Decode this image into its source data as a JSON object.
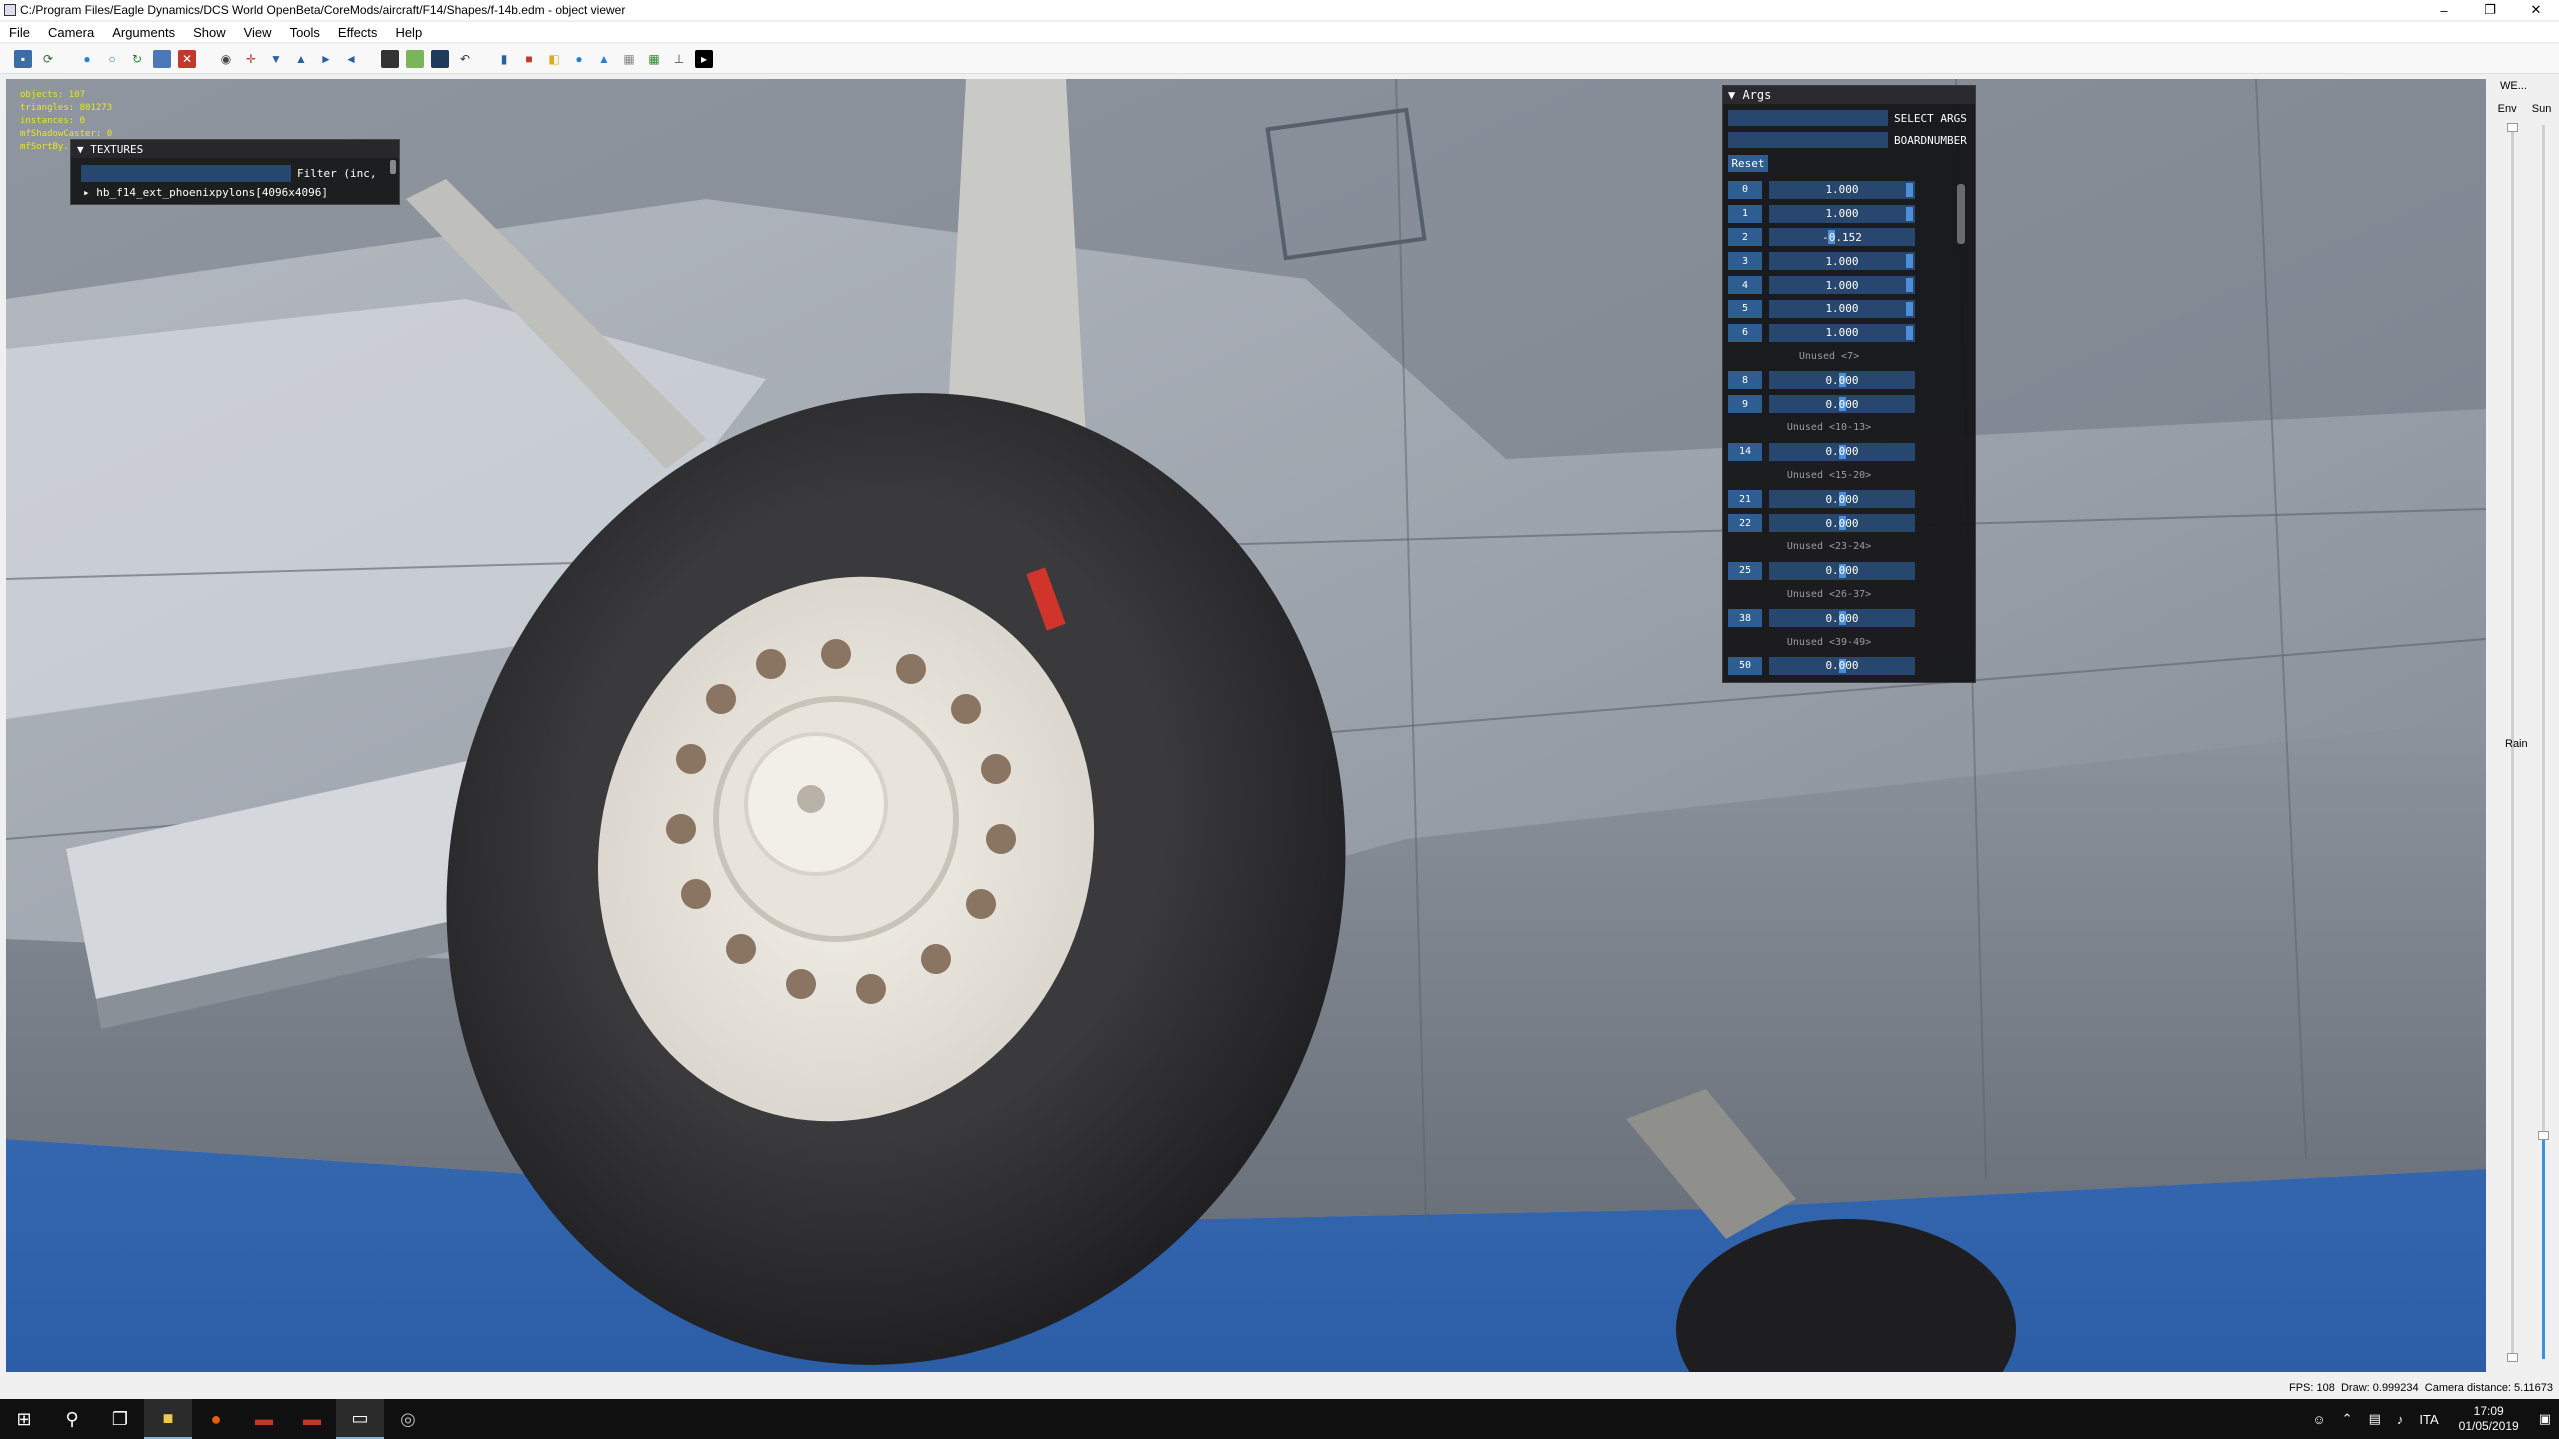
{
  "window": {
    "title": "C:/Program Files/Eagle Dynamics/DCS World OpenBeta/CoreMods/aircraft/F14/Shapes/f-14b.edm - object viewer",
    "minimize": "–",
    "maximize": "❐",
    "close": "✕"
  },
  "menu": [
    "File",
    "Camera",
    "Arguments",
    "Show",
    "View",
    "Tools",
    "Effects",
    "Help"
  ],
  "overlay_stats": [
    "objects: 107",
    "triangles: 801273",
    "instances: 0",
    "mfShadowCaster: 0",
    "mfSortBy..."
  ],
  "textures_panel": {
    "title": "TEXTURES",
    "filter_label": "Filter (inc,",
    "item": "hb_f14_ext_phoenixpylons[4096x4096]"
  },
  "args_panel": {
    "title": "Args",
    "select_label": "SELECT ARGS",
    "board_label": "BOARDNUMBER",
    "reset_label": "Reset",
    "rows": [
      {
        "kind": "arg",
        "index": "0",
        "value": "1.000",
        "fill": 1.0
      },
      {
        "kind": "arg",
        "index": "1",
        "value": "1.000",
        "fill": 1.0
      },
      {
        "kind": "arg",
        "index": "2",
        "value": "-0.152",
        "fill": 0.42
      },
      {
        "kind": "arg",
        "index": "3",
        "value": "1.000",
        "fill": 1.0
      },
      {
        "kind": "arg",
        "index": "4",
        "value": "1.000",
        "fill": 1.0
      },
      {
        "kind": "arg",
        "index": "5",
        "value": "1.000",
        "fill": 1.0
      },
      {
        "kind": "arg",
        "index": "6",
        "value": "1.000",
        "fill": 1.0
      },
      {
        "kind": "unused",
        "label": "Unused <7>"
      },
      {
        "kind": "arg",
        "index": "8",
        "value": "0.000",
        "fill": 0.5
      },
      {
        "kind": "arg",
        "index": "9",
        "value": "0.000",
        "fill": 0.5
      },
      {
        "kind": "unused",
        "label": "Unused <10-13>"
      },
      {
        "kind": "arg",
        "index": "14",
        "value": "0.000",
        "fill": 0.5
      },
      {
        "kind": "unused",
        "label": "Unused <15-20>"
      },
      {
        "kind": "arg",
        "index": "21",
        "value": "0.000",
        "fill": 0.5
      },
      {
        "kind": "arg",
        "index": "22",
        "value": "0.000",
        "fill": 0.5
      },
      {
        "kind": "unused",
        "label": "Unused <23-24>"
      },
      {
        "kind": "arg",
        "index": "25",
        "value": "0.000",
        "fill": 0.5
      },
      {
        "kind": "unused",
        "label": "Unused <26-37>"
      },
      {
        "kind": "arg",
        "index": "38",
        "value": "0.000",
        "fill": 0.5
      },
      {
        "kind": "unused",
        "label": "Unused <39-49>"
      },
      {
        "kind": "arg",
        "index": "50",
        "value": "0.000",
        "fill": 0.5
      }
    ]
  },
  "env_panel": {
    "title": "WE...",
    "env_label": "Env",
    "sun_label": "Sun",
    "rain_label": "Rain"
  },
  "status": {
    "fps": "FPS: 108",
    "draw": "Draw: 0.999234",
    "camera": "Camera distance: 5.11673"
  },
  "taskbar": {
    "language": "ITA",
    "time": "17:09",
    "date": "01/05/2019"
  },
  "colors": {
    "arg_box": "#2e5d91",
    "arg_field": "#28476f",
    "grab": "#4b8fd8",
    "stats_text": "#e8e81a"
  }
}
